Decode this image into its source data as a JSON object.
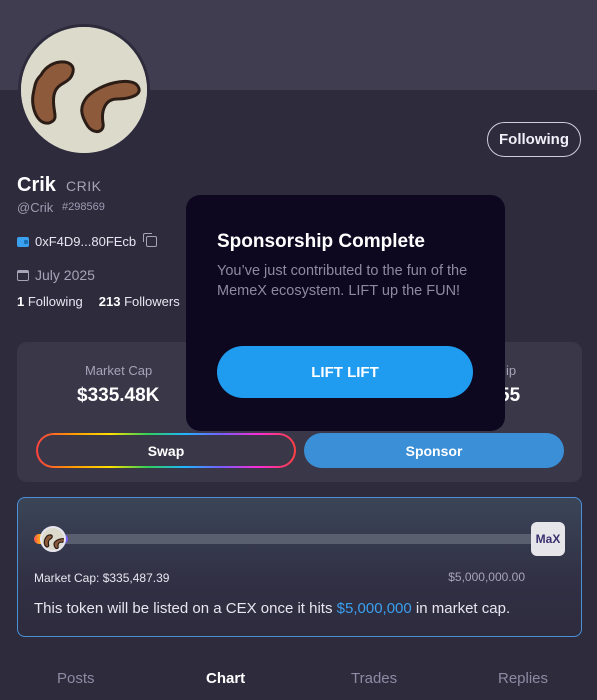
{
  "profile": {
    "follow_button": "Following",
    "name": "Crik",
    "ticker": "CRIK",
    "handle": "@Crik",
    "id": "#298569",
    "wallet": "0xF4D9...80FEcb",
    "joined": "July 2025",
    "following_count": "1",
    "following_label": "Following",
    "followers_count": "213",
    "followers_label": "Followers"
  },
  "stats": {
    "market_cap_label": "Market Cap",
    "market_cap_value": "$335.48K",
    "right_label_partial": "ip",
    "right_value_partial": "55",
    "swap_label": "Swap",
    "sponsor_label": "Sponsor"
  },
  "progress": {
    "fraction": 0.067,
    "logo_text": "MaX",
    "market_cap_text": "Market Cap: $335,487.39",
    "target_text": "$5,000,000.00",
    "cex_prefix": "This token will be listed on a CEX once it hits ",
    "cex_amount": "$5,000,000",
    "cex_suffix": " in market cap."
  },
  "tabs": [
    {
      "label": "Posts"
    },
    {
      "label": "Chart"
    },
    {
      "label": "Trades"
    },
    {
      "label": "Replies"
    }
  ],
  "modal": {
    "title": "Sponsorship Complete",
    "body": "You’ve just contributed to the fun of the MemeX ecosystem. LIFT up the FUN!",
    "button": "LIFT LIFT"
  },
  "colors": {
    "accent": "#1f9bf0",
    "background": "#2e2b3d",
    "modal_bg": "#0d0820"
  }
}
